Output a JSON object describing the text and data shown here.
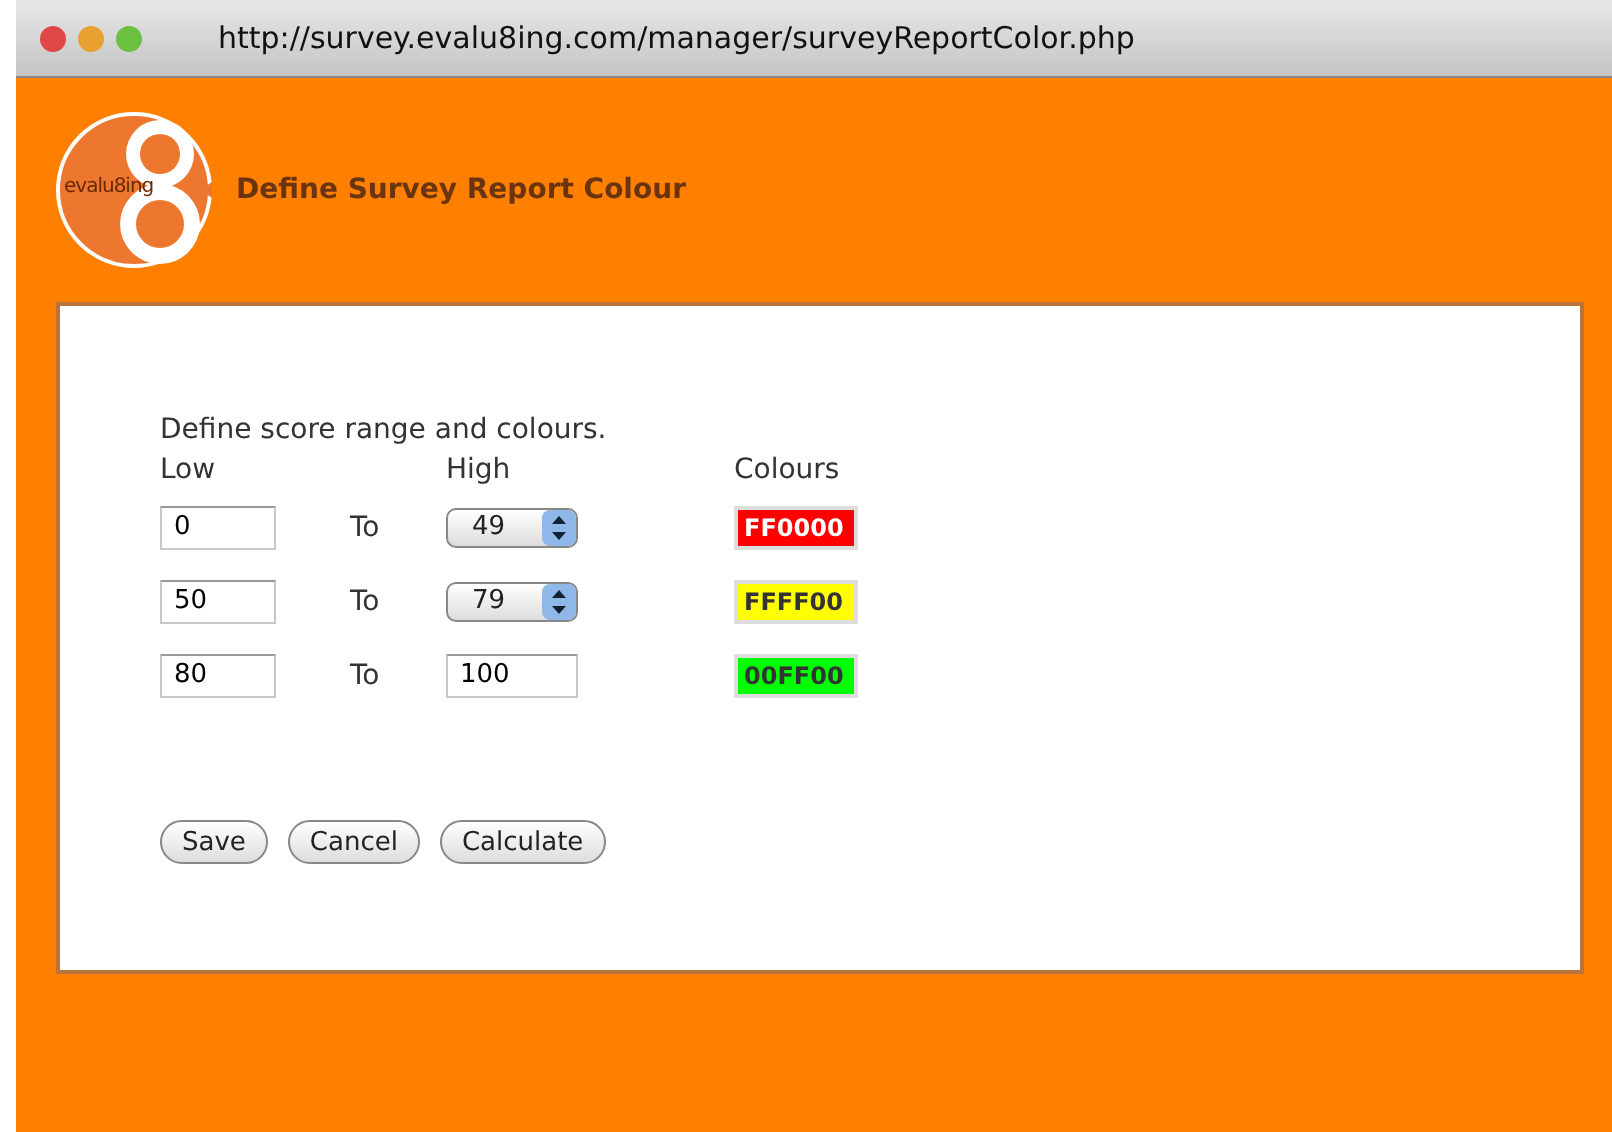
{
  "window": {
    "url": "http://survey.evalu8ing.com/manager/surveyReportColor.php"
  },
  "header": {
    "logo_text": "evalu8ing",
    "title": "Define Survey Report Colour"
  },
  "form": {
    "intro": "Define score range and colours.",
    "columns": [
      "Low",
      "High",
      "Colours"
    ],
    "rows": [
      {
        "low": "0",
        "separator": "To",
        "high": {
          "kind": "select",
          "value": "49"
        },
        "colour": "FF0000",
        "color": "#ff0000"
      },
      {
        "low": "50",
        "separator": "To",
        "high": {
          "kind": "select",
          "value": "79"
        },
        "colour": "FFFF00",
        "color": "#ffff00"
      },
      {
        "low": "80",
        "separator": "To",
        "high": {
          "kind": "input",
          "value": "100"
        },
        "colour": "00FF00",
        "color": "#00ff00"
      }
    ],
    "buttons": [
      "Save",
      "Cancel",
      "Calculate"
    ]
  }
}
